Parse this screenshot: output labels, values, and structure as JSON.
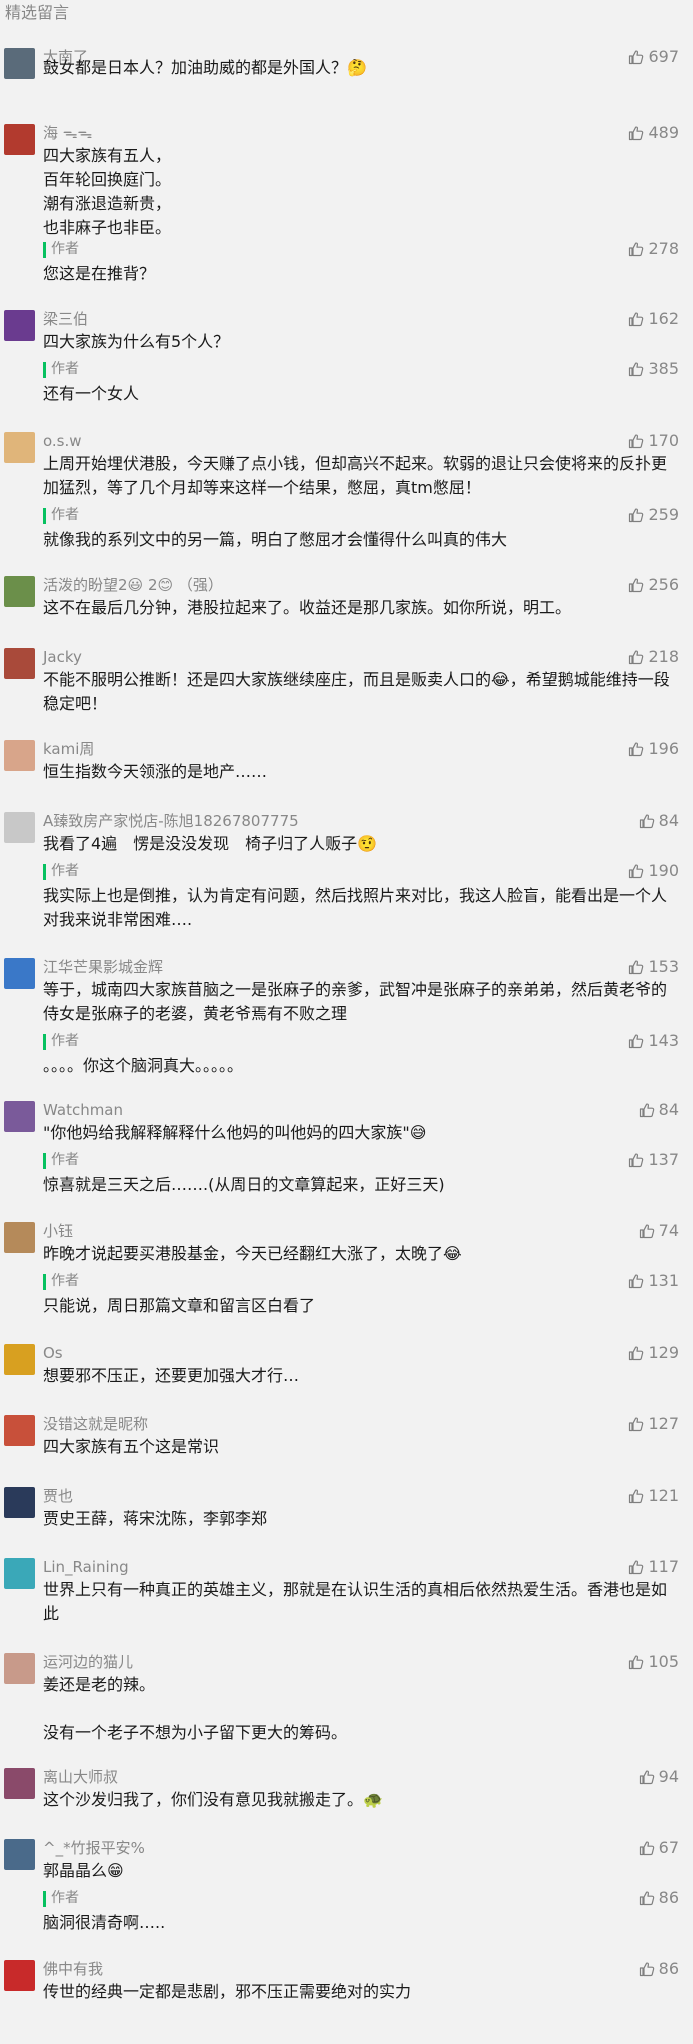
{
  "section_title": "精选留言",
  "comments": [
    {
      "nick": "太南了",
      "likes": "697",
      "content": "鼓女都是日本人？加油助威的都是外国人？",
      "emoji": "🤔",
      "avatar_color": "#5a6b7a"
    },
    {
      "nick": "海 ᯓᯓ",
      "likes": "489",
      "content": "四大家族有五人，\n百年轮回换庭门。\n潮有涨退造新贵，\n也非麻子也非臣。",
      "reply_label": "作者",
      "reply_likes": "278",
      "reply": "您这是在推背？",
      "avatar_color": "#b23a2e"
    },
    {
      "nick": "梁三伯",
      "likes": "162",
      "content": "四大家族为什么有5个人？",
      "reply_label": "作者",
      "reply_likes": "385",
      "reply": "还有一个女人",
      "avatar_color": "#6a3b8f"
    },
    {
      "nick": "o.s.w",
      "likes": "170",
      "content": "上周开始埋伏港股，今天赚了点小钱，但却高兴不起来。软弱的退让只会使将来的反扑更加猛烈，等了几个月却等来这样一个结果，憋屈，真tm憋屈！",
      "reply_label": "作者",
      "reply_likes": "259",
      "reply": "就像我的系列文中的另一篇，明白了憋屈才会懂得什么叫真的伟大",
      "avatar_color": "#e0b57a"
    },
    {
      "nick": "活泼的盼望2😃 2😊 （强）",
      "likes": "256",
      "content": "这不在最后几分钟，港股拉起来了。收益还是那几家族。如你所说，明工。",
      "avatar_color": "#6b8f4a"
    },
    {
      "nick": "Jacky",
      "likes": "218",
      "content": "不能不服明公推断！还是四大家族继续座庄，而且是贩卖人口的😂，希望鹅城能维持一段稳定吧！",
      "avatar_color": "#a94a3a"
    },
    {
      "nick": "kami周",
      "likes": "196",
      "content": "恒生指数今天领涨的是地产……",
      "avatar_color": "#d8a58a"
    },
    {
      "nick": "A臻致房产家悦店-陈旭18267807775",
      "likes": "84",
      "content": "我看了4遍　愣是没没发现　椅子归了人贩子🤨",
      "reply_label": "作者",
      "reply_likes": "190",
      "reply": "我实际上也是倒推，认为肯定有问题，然后找照片来对比，我这人脸盲，能看出是一个人对我来说非常困难….",
      "avatar_color": "#c8c8c8"
    },
    {
      "nick": "江华芒果影城金辉",
      "likes": "153",
      "content": "等于，城南四大家族苜脑之一是张麻子的亲爹，武智冲是张麻子的亲弟弟，然后黄老爷的侍女是张麻子的老婆，黄老爷焉有不败之理",
      "reply_label": "作者",
      "reply_likes": "143",
      "reply": "。。。。你这个脑洞真大。。。。。",
      "avatar_color": "#3a78c8"
    },
    {
      "nick": "Watchman",
      "likes": "84",
      "content": "\"你他妈给我解释解释什么他妈的叫他妈的四大家族\"😅",
      "reply_label": "作者",
      "reply_likes": "137",
      "reply": "惊喜就是三天之后…….(从周日的文章算起来，正好三天)",
      "avatar_color": "#7a5a9a"
    },
    {
      "nick": "小钰",
      "likes": "74",
      "content": "昨晚才说起要买港股基金，今天已经翻红大涨了，太晚了😂",
      "reply_label": "作者",
      "reply_likes": "131",
      "reply": "只能说，周日那篇文章和留言区白看了",
      "avatar_color": "#b58a5a"
    },
    {
      "nick": "Os",
      "likes": "129",
      "content": "想要邪不压正，还要更加强大才行…",
      "avatar_color": "#d8a020"
    },
    {
      "nick": "没错这就是昵称",
      "likes": "127",
      "content": "四大家族有五个这是常识",
      "avatar_color": "#c8503a"
    },
    {
      "nick": "贾也",
      "likes": "121",
      "content": "贾史王薛，蒋宋沈陈，李郭李郑",
      "avatar_color": "#2a3a5a"
    },
    {
      "nick": "Lin_Raining",
      "likes": "117",
      "content": "世界上只有一种真正的英雄主义，那就是在认识生活的真相后依然热爱生活。香港也是如此",
      "avatar_color": "#3aa8b8"
    },
    {
      "nick": "运河边的猫儿",
      "likes": "105",
      "content": "姜还是老的辣。\n\n没有一个老子不想为小子留下更大的筹码。",
      "avatar_color": "#c89a8a"
    },
    {
      "nick": "离山大师叔",
      "likes": "94",
      "content": "这个沙发归我了，你们没有意见我就搬走了。🐢",
      "avatar_color": "#8a4a6a"
    },
    {
      "nick": "^_*竹报平安%",
      "likes": "67",
      "content": "郭晶晶么😁",
      "reply_label": "作者",
      "reply_likes": "86",
      "reply": "脑洞很清奇啊…..",
      "avatar_color": "#4a6a8a"
    },
    {
      "nick": "佛中有我",
      "likes": "86",
      "content": "传世的经典一定都是悲剧，邪不压正需要绝对的实力",
      "avatar_color": "#c82a2a"
    }
  ]
}
